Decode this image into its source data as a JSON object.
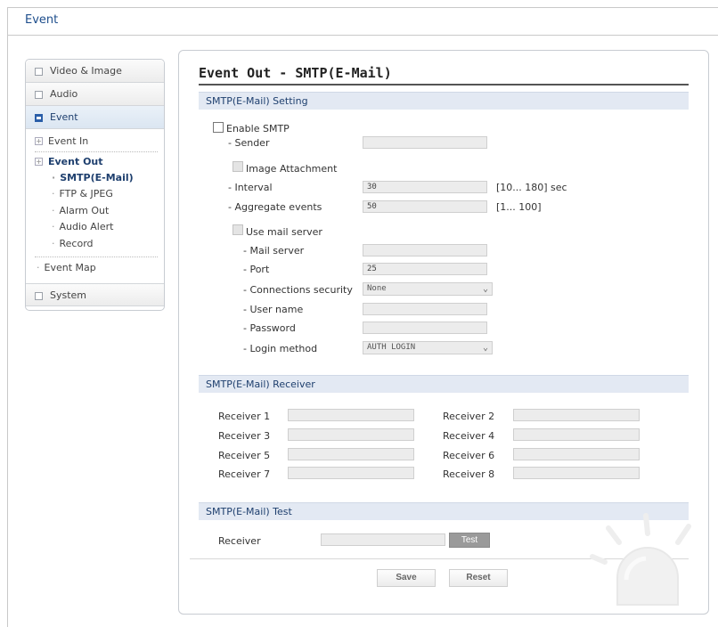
{
  "header": {
    "title": "Event"
  },
  "sidebar": {
    "video_image": "Video & Image",
    "audio": "Audio",
    "event": "Event",
    "event_in": "Event In",
    "event_out": "Event Out",
    "smtp": "SMTP(E-Mail)",
    "ftp": "FTP & JPEG",
    "alarm_out": "Alarm Out",
    "audio_alert": "Audio Alert",
    "record": "Record",
    "event_map": "Event Map",
    "system": "System"
  },
  "main": {
    "title": "Event Out - SMTP(E-Mail)",
    "setting": {
      "section": "SMTP(E-Mail) Setting",
      "enable_smtp": "Enable SMTP",
      "sender": "- Sender",
      "image_attachment": "Image Attachment",
      "interval": "- Interval",
      "interval_value": "30",
      "interval_range": "[10... 180] sec",
      "aggregate": "- Aggregate events",
      "aggregate_value": "50",
      "aggregate_range": "[1... 100]",
      "use_mail_server": "Use mail server",
      "mail_server": "- Mail server",
      "port": "- Port",
      "port_value": "25",
      "conn_security": "- Connections security",
      "conn_security_value": "None",
      "user_name": "- User name",
      "password": "- Password",
      "login_method": "- Login method",
      "login_method_value": "AUTH LOGIN"
    },
    "receiver": {
      "section": "SMTP(E-Mail) Receiver",
      "r1": "Receiver 1",
      "r2": "Receiver 2",
      "r3": "Receiver 3",
      "r4": "Receiver 4",
      "r5": "Receiver 5",
      "r6": "Receiver 6",
      "r7": "Receiver 7",
      "r8": "Receiver 8"
    },
    "test": {
      "section": "SMTP(E-Mail) Test",
      "receiver": "Receiver",
      "test_button": "Test"
    },
    "save_button": "Save",
    "reset_button": "Reset"
  }
}
